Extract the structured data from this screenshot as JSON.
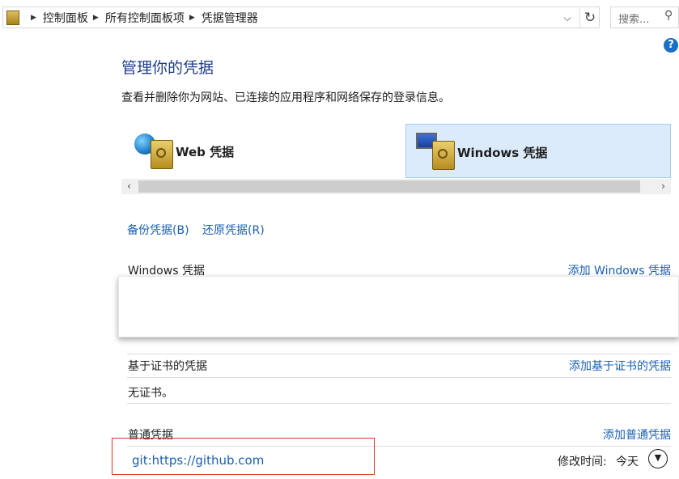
{
  "breadcrumb": [
    "控制面板",
    "所有控制面板项",
    "凭据管理器"
  ],
  "search": {
    "placeholder": "搜索..."
  },
  "help_label": "?",
  "page": {
    "title": "管理你的凭据",
    "description": "查看并删除你为网站、已连接的应用程序和网络保存的登录信息。"
  },
  "tabs": [
    {
      "label": "Web 凭据",
      "selected": false
    },
    {
      "label": "Windows 凭据",
      "selected": true
    }
  ],
  "actions": {
    "backup": "备份凭据(B)",
    "restore": "还原凭据(R)"
  },
  "sections": {
    "windows": {
      "title": "Windows 凭据",
      "add": "添加 Windows 凭据"
    },
    "cert": {
      "title": "基于证书的凭据",
      "add": "添加基于证书的凭据",
      "empty": "无证书。"
    },
    "generic": {
      "title": "普通凭据",
      "add": "添加普通凭据",
      "items": [
        {
          "name": "git:https://github.com",
          "modified_label": "修改时间:",
          "modified_value": "今天"
        }
      ]
    }
  },
  "colors": {
    "link": "#1a5fb4",
    "title": "#1f3e8a",
    "selected_tab": "#dcebfc",
    "highlight_box": "#d9342b"
  }
}
